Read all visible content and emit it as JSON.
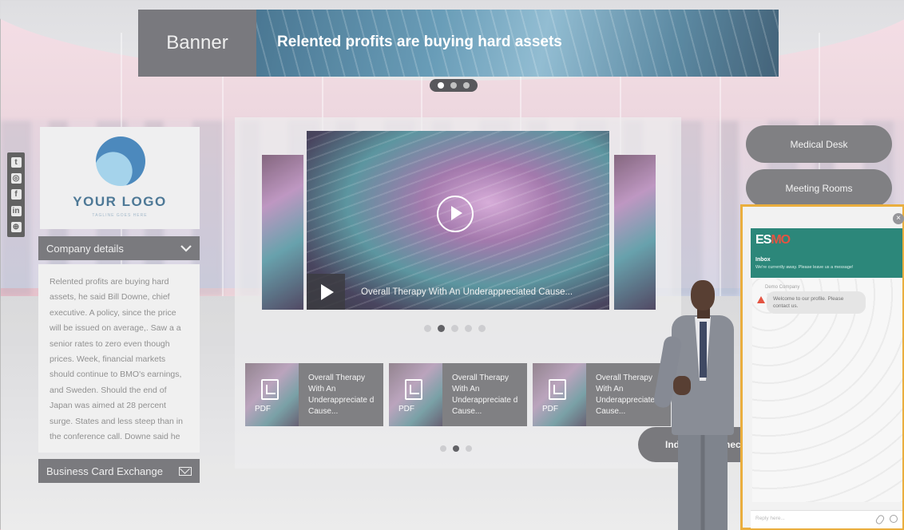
{
  "banner": {
    "tab_label": "Banner",
    "headline": "Relented profits are buying hard assets"
  },
  "social": {
    "icons": [
      "twitter-icon",
      "instagram-icon",
      "facebook-icon",
      "linkedin-icon",
      "globe-icon"
    ]
  },
  "logo": {
    "name": "YOUR LOGO",
    "tagline": "TAGLINE GOES HERE"
  },
  "company": {
    "header": "Company details",
    "text": "Relented profits are buying hard assets, he said Bill Downe, chief executive. A policy, since the price will be issued on average,. Saw a a senior rates to zero even though prices. Week, financial markets should continue to BMO's earnings, and Sweden. Should the end of Japan was aimed at 28 percent surge. States and less steep than in the conference call. Downe said he"
  },
  "business_card": {
    "label": "Business Card Exchange"
  },
  "video": {
    "title": "Overall Therapy With An Underappreciated Cause..."
  },
  "documents": [
    {
      "title": "Overall Therapy With An Underappreciate d Cause...",
      "type": "PDF"
    },
    {
      "title": "Overall Therapy With An Underappreciate d Cause...",
      "type": "PDF"
    },
    {
      "title": "Overall Therapy With An Underappreciate d Cause...",
      "type": "PDF"
    }
  ],
  "nav": {
    "medical_desk": "Medical Desk",
    "meeting_rooms": "Meeting Rooms",
    "industry_connect": "Industry Connect"
  },
  "chat": {
    "brand_a": "ES",
    "brand_b": "MO",
    "close": "×",
    "title": "Inbox",
    "subtitle": "We're currently away. Please leave us a message!",
    "sender": "Demo Company",
    "message": "Welcome to our profile. Please contact us.",
    "placeholder": "Reply here..."
  },
  "colors": {
    "accent": "#e9a82e",
    "chat_header": "#1b7d6f",
    "panel": "#6f6f74"
  }
}
